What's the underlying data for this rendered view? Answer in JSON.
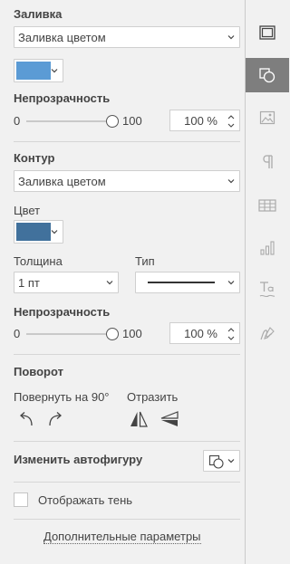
{
  "fill": {
    "title": "Заливка",
    "type_value": "Заливка цветом",
    "color": "#5b9bd5"
  },
  "fill_opacity": {
    "title": "Непрозрачность",
    "min": "0",
    "max": "100",
    "value_text": "100 %",
    "value": 100
  },
  "stroke": {
    "title": "Контур",
    "type_value": "Заливка цветом",
    "color_label": "Цвет",
    "color": "#41719c",
    "width_label": "Толщина",
    "width_value": "1 пт",
    "type_label": "Тип"
  },
  "stroke_opacity": {
    "title": "Непрозрачность",
    "min": "0",
    "max": "100",
    "value_text": "100 %",
    "value": 100
  },
  "rotation": {
    "title": "Поворот",
    "rotate_label": "Повернуть на 90°",
    "flip_label": "Отразить"
  },
  "autoshape": {
    "title": "Изменить автофигуру"
  },
  "shadow": {
    "label": "Отображать тень",
    "checked": false
  },
  "advanced_link": "Дополнительные параметры",
  "rail": {
    "items": [
      "slide-settings-icon",
      "shape-settings-icon",
      "image-settings-icon",
      "paragraph-settings-icon",
      "table-settings-icon",
      "chart-settings-icon",
      "textart-settings-icon",
      "signature-settings-icon"
    ],
    "active": "shape-settings-icon"
  }
}
